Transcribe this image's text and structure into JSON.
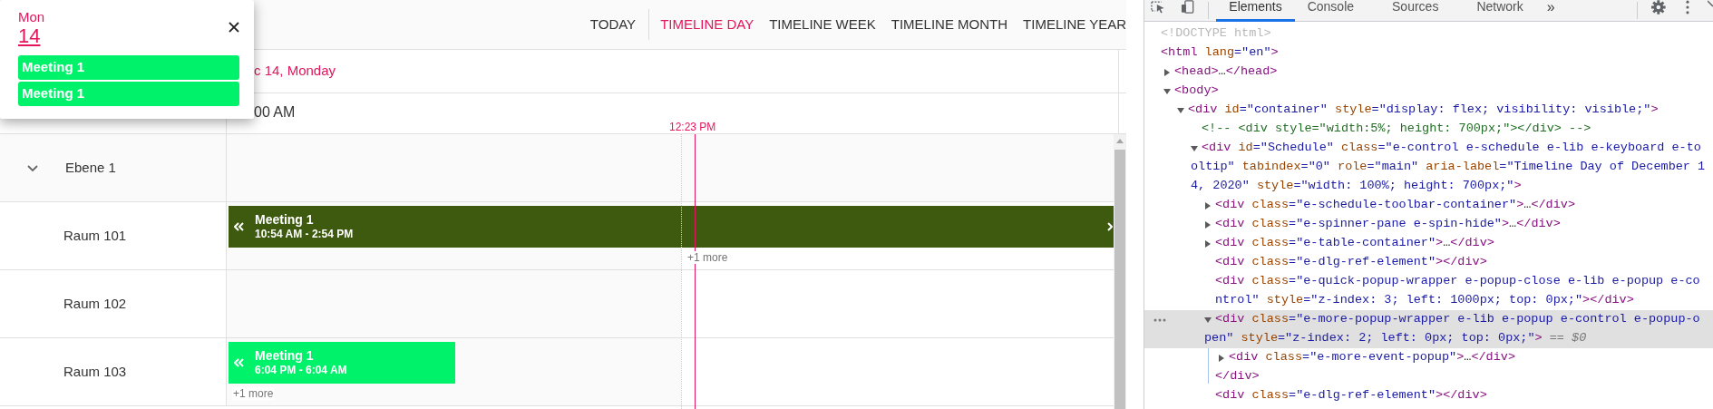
{
  "scheduler": {
    "toolbar": {
      "today": "TODAY",
      "views": [
        {
          "label": "TIMELINE DAY",
          "selected": true
        },
        {
          "label": "TIMELINE WEEK",
          "selected": false
        },
        {
          "label": "TIMELINE MONTH",
          "selected": false
        },
        {
          "label": "TIMELINE YEAR",
          "selected": false
        }
      ]
    },
    "date_header": "c 14, Monday",
    "time_header": "00 AM",
    "current_time": "12:23 PM",
    "resources": [
      {
        "name": "Ebene 1",
        "expanded": true,
        "children": [
          {
            "name": "Raum 101",
            "events": [
              {
                "title": "Meeting 1",
                "time": "10:54 AM - 2:54 PM",
                "color": "#3d5a0f",
                "continues_left": true,
                "continues_right": true
              }
            ],
            "more": "+1 more"
          },
          {
            "name": "Raum 102"
          },
          {
            "name": "Raum 103",
            "events": [
              {
                "title": "Meeting 1",
                "time": "6:04 PM - 6:04 AM",
                "color": "#00f26b",
                "continues_left": true,
                "continues_right": false
              }
            ],
            "more": "+1 more"
          }
        ]
      }
    ]
  },
  "more_popup": {
    "day": "Mon",
    "date": "14",
    "events": [
      {
        "title": "Meeting 1",
        "color": "#00f26b"
      },
      {
        "title": "Meeting 1",
        "color": "#00f26b"
      }
    ]
  },
  "devtools": {
    "tabs": [
      {
        "label": "Elements",
        "selected": true
      },
      {
        "label": "Console",
        "selected": false
      },
      {
        "label": "Sources",
        "selected": false
      },
      {
        "label": "Network",
        "selected": false
      }
    ],
    "overflow": "»",
    "tree": [
      {
        "selected": false,
        "lines": [
          [
            {
              "kind": "doctype",
              "text": "<!DOCTYPE html>"
            }
          ]
        ]
      },
      {
        "selected": false,
        "lines": [
          [
            {
              "kind": "tag",
              "text": "<html "
            },
            {
              "kind": "attr",
              "text": "lang"
            },
            {
              "kind": "value",
              "text": "=\"en\""
            },
            {
              "kind": "tag",
              "text": ">"
            }
          ]
        ],
        "children": [
          {
            "selected": false,
            "expanded": false,
            "lines": [
              [
                {
                  "kind": "tag",
                  "text": "<head>"
                },
                {
                  "kind": "plain",
                  "text": "…"
                },
                {
                  "kind": "tag",
                  "text": "</head>"
                }
              ]
            ]
          },
          {
            "selected": false,
            "expanded": true,
            "lines": [
              [
                {
                  "kind": "tag",
                  "text": "<body>"
                }
              ]
            ],
            "children": [
              {
                "selected": false,
                "expanded": true,
                "lines": [
                  [
                    {
                      "kind": "tag",
                      "text": "<div "
                    },
                    {
                      "kind": "attr",
                      "text": "id"
                    },
                    {
                      "kind": "value",
                      "text": "=\"container\""
                    },
                    {
                      "kind": "attr",
                      "text": " style"
                    },
                    {
                      "kind": "value",
                      "text": "=\"display: flex; visibility: visible;\""
                    },
                    {
                      "kind": "tag",
                      "text": ">"
                    }
                  ]
                ],
                "children": [
                  {
                    "selected": false,
                    "lines": [
                      [
                        {
                          "kind": "comment",
                          "text": "<!-- <div style=\"width:5%; height: 700px;\"></div> -->"
                        }
                      ]
                    ]
                  },
                  {
                    "selected": false,
                    "expanded": true,
                    "lines": [
                      [
                        {
                          "kind": "tag",
                          "text": "<div "
                        },
                        {
                          "kind": "attr",
                          "text": "id"
                        },
                        {
                          "kind": "value",
                          "text": "=\"Schedule\""
                        },
                        {
                          "kind": "attr",
                          "text": " class"
                        },
                        {
                          "kind": "value",
                          "text": "=\"e-control e-schedule e-lib e-keyboard e-to"
                        }
                      ],
                      [
                        {
                          "kind": "value",
                          "text": "oltip\""
                        },
                        {
                          "kind": "attr",
                          "text": " tabindex"
                        },
                        {
                          "kind": "value",
                          "text": "=\"0\""
                        },
                        {
                          "kind": "attr",
                          "text": " role"
                        },
                        {
                          "kind": "value",
                          "text": "=\"main\""
                        },
                        {
                          "kind": "attr",
                          "text": " aria-label"
                        },
                        {
                          "kind": "value",
                          "text": "=\"Timeline Day of December 1"
                        }
                      ],
                      [
                        {
                          "kind": "value",
                          "text": "4, 2020\""
                        },
                        {
                          "kind": "attr",
                          "text": " style"
                        },
                        {
                          "kind": "value",
                          "text": "=\"width: 100%; height: 700px;\""
                        },
                        {
                          "kind": "tag",
                          "text": ">"
                        }
                      ]
                    ],
                    "children": [
                      {
                        "selected": false,
                        "expanded": false,
                        "lines": [
                          [
                            {
                              "kind": "tag",
                              "text": "<div "
                            },
                            {
                              "kind": "attr",
                              "text": "class"
                            },
                            {
                              "kind": "value",
                              "text": "=\"e-schedule-toolbar-container\""
                            },
                            {
                              "kind": "tag",
                              "text": ">"
                            },
                            {
                              "kind": "plain",
                              "text": "…"
                            },
                            {
                              "kind": "tag",
                              "text": "</div>"
                            }
                          ]
                        ]
                      },
                      {
                        "selected": false,
                        "expanded": false,
                        "lines": [
                          [
                            {
                              "kind": "tag",
                              "text": "<div "
                            },
                            {
                              "kind": "attr",
                              "text": "class"
                            },
                            {
                              "kind": "value",
                              "text": "=\"e-spinner-pane e-spin-hide\""
                            },
                            {
                              "kind": "tag",
                              "text": ">"
                            },
                            {
                              "kind": "plain",
                              "text": "…"
                            },
                            {
                              "kind": "tag",
                              "text": "</div>"
                            }
                          ]
                        ]
                      },
                      {
                        "selected": false,
                        "expanded": false,
                        "lines": [
                          [
                            {
                              "kind": "tag",
                              "text": "<div "
                            },
                            {
                              "kind": "attr",
                              "text": "class"
                            },
                            {
                              "kind": "value",
                              "text": "=\"e-table-container\""
                            },
                            {
                              "kind": "tag",
                              "text": ">"
                            },
                            {
                              "kind": "plain",
                              "text": "…"
                            },
                            {
                              "kind": "tag",
                              "text": "</div>"
                            }
                          ]
                        ]
                      },
                      {
                        "selected": false,
                        "lines": [
                          [
                            {
                              "kind": "tag",
                              "text": "<div "
                            },
                            {
                              "kind": "attr",
                              "text": "class"
                            },
                            {
                              "kind": "value",
                              "text": "=\"e-dlg-ref-element\""
                            },
                            {
                              "kind": "tag",
                              "text": "></div>"
                            }
                          ]
                        ]
                      },
                      {
                        "selected": false,
                        "lines": [
                          [
                            {
                              "kind": "tag",
                              "text": "<div "
                            },
                            {
                              "kind": "attr",
                              "text": "class"
                            },
                            {
                              "kind": "value",
                              "text": "=\"e-quick-popup-wrapper e-popup-close e-lib e-popup e-co"
                            }
                          ],
                          [
                            {
                              "kind": "value",
                              "text": "ntrol\""
                            },
                            {
                              "kind": "attr",
                              "text": " style"
                            },
                            {
                              "kind": "value",
                              "text": "=\"z-index: 3; left: 1000px; top: 0px;\""
                            },
                            {
                              "kind": "tag",
                              "text": "></div>"
                            }
                          ]
                        ]
                      },
                      {
                        "selected": true,
                        "expanded": true,
                        "closing": "</div>",
                        "lines": [
                          [
                            {
                              "kind": "tag",
                              "text": "<div "
                            },
                            {
                              "kind": "attr",
                              "text": "class"
                            },
                            {
                              "kind": "value",
                              "text": "=\"e-more-popup-wrapper e-lib e-popup e-control e-popup-o"
                            }
                          ],
                          [
                            {
                              "kind": "value",
                              "text": "pen\""
                            },
                            {
                              "kind": "attr",
                              "text": " style"
                            },
                            {
                              "kind": "value",
                              "text": "=\"z-index: 2; left: 0px; top: 0px;\""
                            },
                            {
                              "kind": "tag",
                              "text": ">"
                            },
                            {
                              "kind": "ref",
                              "text": " == $0"
                            }
                          ]
                        ],
                        "children": [
                          {
                            "selected": false,
                            "expanded": false,
                            "lines": [
                              [
                                {
                                  "kind": "tag",
                                  "text": "<div "
                                },
                                {
                                  "kind": "attr",
                                  "text": "class"
                                },
                                {
                                  "kind": "value",
                                  "text": "=\"e-more-event-popup\""
                                },
                                {
                                  "kind": "tag",
                                  "text": ">"
                                },
                                {
                                  "kind": "plain",
                                  "text": "…"
                                },
                                {
                                  "kind": "tag",
                                  "text": "</div>"
                                }
                              ]
                            ]
                          }
                        ]
                      },
                      {
                        "selected": false,
                        "lines": [
                          [
                            {
                              "kind": "tag",
                              "text": "<div "
                            },
                            {
                              "kind": "attr",
                              "text": "class"
                            },
                            {
                              "kind": "value",
                              "text": "=\"e-dlg-ref-element\""
                            },
                            {
                              "kind": "tag",
                              "text": "></div>"
                            }
                          ]
                        ]
                      }
                    ]
                  }
                ]
              }
            ]
          }
        ]
      }
    ]
  }
}
